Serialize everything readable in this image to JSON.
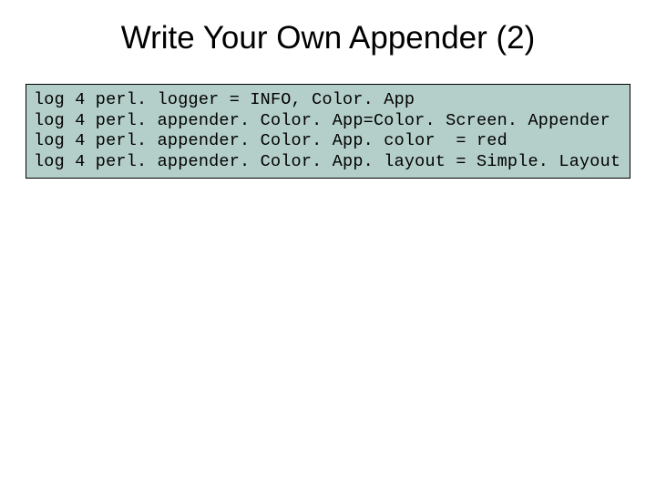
{
  "title": "Write Your Own Appender (2)",
  "code": {
    "line1": "log 4 perl. logger = INFO, Color. App",
    "line2": "log 4 perl. appender. Color. App=Color. Screen. Appender",
    "line3": "log 4 perl. appender. Color. App. color  = red",
    "line4": "log 4 perl. appender. Color. App. layout = Simple. Layout"
  }
}
